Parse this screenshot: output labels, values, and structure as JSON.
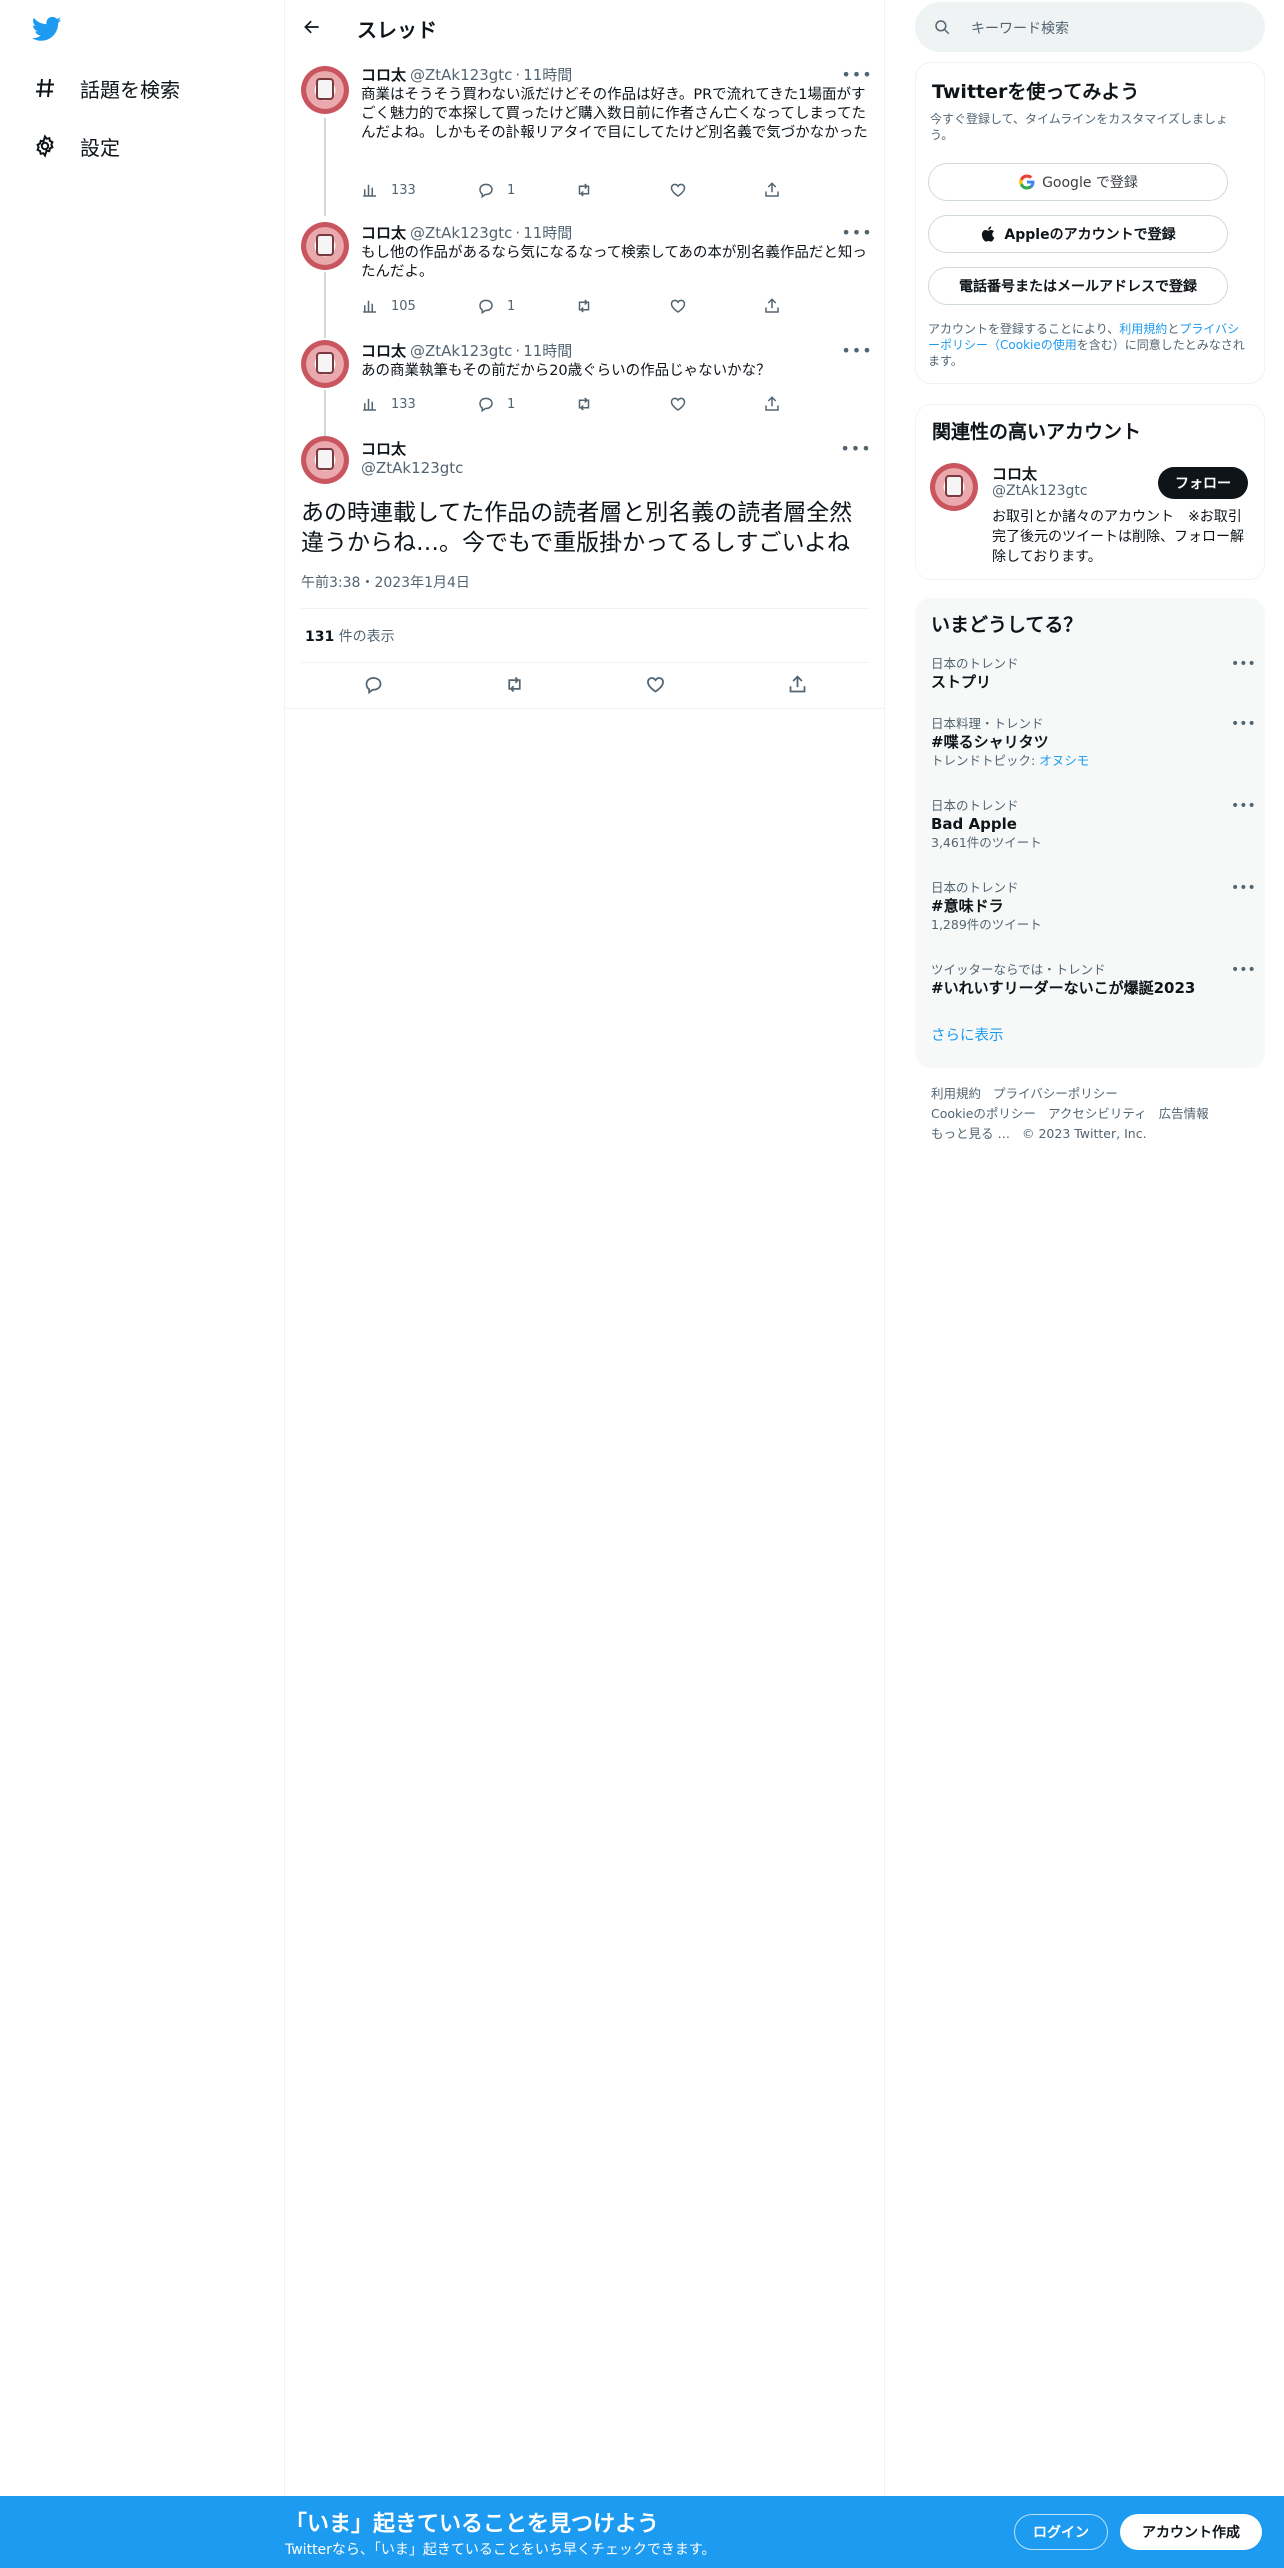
{
  "nav": {
    "logo": "twitter-bird-icon",
    "items": [
      {
        "label": "話題を検索",
        "icon": "hashtag-icon"
      },
      {
        "label": "設定",
        "icon": "gear-icon"
      }
    ]
  },
  "header": {
    "title": "スレッド"
  },
  "thread": [
    {
      "name": "コロ太",
      "handle": "@ZtAk123gtc",
      "sep": "·",
      "time": "11時間",
      "text": "商業はそうそう買わない派だけどその作品は好き。PRで流れてきた1場面がすごく魅力的で本探して買ったけど購入数日前に作者さん亡くなってしまってたんだよね。しかもその訃報リアタイで目にしてたけど別名義で気づかなかった",
      "views": "133",
      "replies": "1"
    },
    {
      "name": "コロ太",
      "handle": "@ZtAk123gtc",
      "sep": "·",
      "time": "11時間",
      "text": "もし他の作品があるなら気になるなって検索してあの本が別名義作品だと知ったんだよ。",
      "views": "105",
      "replies": "1"
    },
    {
      "name": "コロ太",
      "handle": "@ZtAk123gtc",
      "sep": "·",
      "time": "11時間",
      "text": "あの商業執筆もその前だから20歳ぐらいの作品じゃないかな？",
      "views": "133",
      "replies": "1"
    }
  ],
  "main_tweet": {
    "name": "コロ太",
    "handle": "@ZtAk123gtc",
    "text": "あの時連載してた作品の読者層と別名義の読者層全然違うからね…。今でもで重版掛かってるしすごいよね",
    "date": "午前3:38・2023年1月4日",
    "views_count": "131",
    "views_label": "件の表示"
  },
  "search": {
    "placeholder": "キーワード検索"
  },
  "signup_card": {
    "title": "Twitterを使ってみよう",
    "subtitle": "今すぐ登録して、タイムラインをカスタマイズしましょう。",
    "google_label": "Google で登録",
    "apple_label": "Appleのアカウントで登録",
    "phone_label": "電話番号またはメールアドレスで登録",
    "terms_prefix": "アカウントを登録することにより、",
    "terms_link1": "利用規約",
    "terms_and": "と",
    "terms_link2": "プライバシーポリシー（Cookieの使用",
    "terms_suffix": "を含む）に同意したとみなされます。"
  },
  "related": {
    "title": "関連性の高いアカウント",
    "name": "コロ太",
    "handle": "@ZtAk123gtc",
    "bio": "お取引とか諸々のアカウント　※お取引完了後元のツイートは削除、フォロー解除しております。",
    "follow_label": "フォロー"
  },
  "trends": {
    "title": "いまどうしてる？",
    "items": [
      {
        "meta": "日本のトレンド",
        "name": "ストプリ",
        "sub": ""
      },
      {
        "meta": "日本料理・トレンド",
        "name": "#喋るシャリタツ",
        "sub_prefix": "トレンドトピック: ",
        "sub_link": "オヌシモ"
      },
      {
        "meta": "日本のトレンド",
        "name": "Bad Apple",
        "sub": "3,461件のツイート"
      },
      {
        "meta": "日本のトレンド",
        "name": "#意味ドラ",
        "sub": "1,289件のツイート"
      },
      {
        "meta": "ツイッターならでは・トレンド",
        "name": "#いれいすリーダーないこが爆誕2023",
        "sub": ""
      }
    ],
    "show_more": "さらに表示"
  },
  "footer": {
    "links": [
      "利用規約",
      "プライバシーポリシー",
      "Cookieのポリシー",
      "アクセシビリティ",
      "広告情報",
      "もっと見る …",
      "© 2023 Twitter, Inc."
    ]
  },
  "banner": {
    "title": "「いま」起きていることを見つけよう",
    "subtitle": "Twitterなら、「いま」起きていることをいち早くチェックできます。",
    "login_label": "ログイン",
    "signup_label": "アカウント作成"
  },
  "colors": {
    "accent": "#1d9bf0",
    "text": "#0f1419",
    "muted": "#536471",
    "border": "#eff3f4"
  }
}
